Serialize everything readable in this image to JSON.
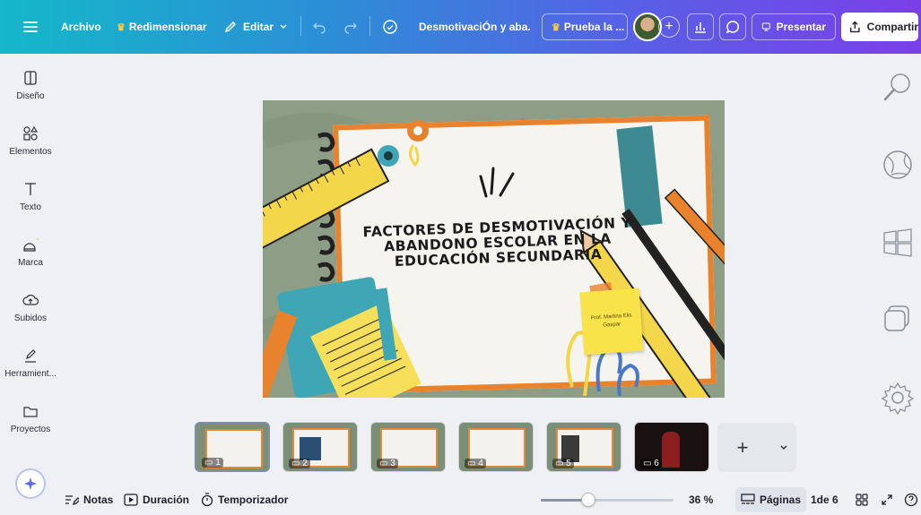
{
  "topbar": {
    "menu_icon": "hamburger-icon",
    "file_label": "Archivo",
    "resize_label": "Redimensionar",
    "edit_label": "Editar",
    "doc_title": "DesmotivaciÓn y aba...",
    "trial_label": "Prueba la ...",
    "present_label": "Presentar",
    "share_label": "Compartir"
  },
  "sidebar": {
    "items": [
      {
        "label": "Diseño",
        "icon": "layout-icon"
      },
      {
        "label": "Elementos",
        "icon": "shapes-icon"
      },
      {
        "label": "Texto",
        "icon": "text-icon"
      },
      {
        "label": "Marca",
        "icon": "brand-icon"
      },
      {
        "label": "Subidos",
        "icon": "upload-icon"
      },
      {
        "label": "Herramient...",
        "icon": "draw-icon"
      },
      {
        "label": "Proyectos",
        "icon": "folder-icon"
      }
    ]
  },
  "slide": {
    "title_line1": "FACTORES DE DESMOTIVACIÓN Y",
    "title_line2": "ABANDONO ESCOLAR EN LA",
    "title_line3": "EDUCACIÓN SECUNDARIA",
    "author": "Prof. Martina Elis Gaspar"
  },
  "thumbnails": [
    {
      "num": "1",
      "active": true
    },
    {
      "num": "2",
      "active": false
    },
    {
      "num": "3",
      "active": false
    },
    {
      "num": "4",
      "active": false
    },
    {
      "num": "5",
      "active": false
    },
    {
      "num": "6",
      "active": false
    }
  ],
  "bottombar": {
    "notes_label": "Notas",
    "duration_label": "Duración",
    "timer_label": "Temporizador",
    "zoom_value": "36 %",
    "zoom_fraction": 0.36,
    "pages_label": "Páginas",
    "page_indicator": "1de 6"
  },
  "colors": {
    "accent_orange": "#e8822c",
    "sticky_yellow": "#f8e34a",
    "canvas_green": "#8e9e86"
  }
}
